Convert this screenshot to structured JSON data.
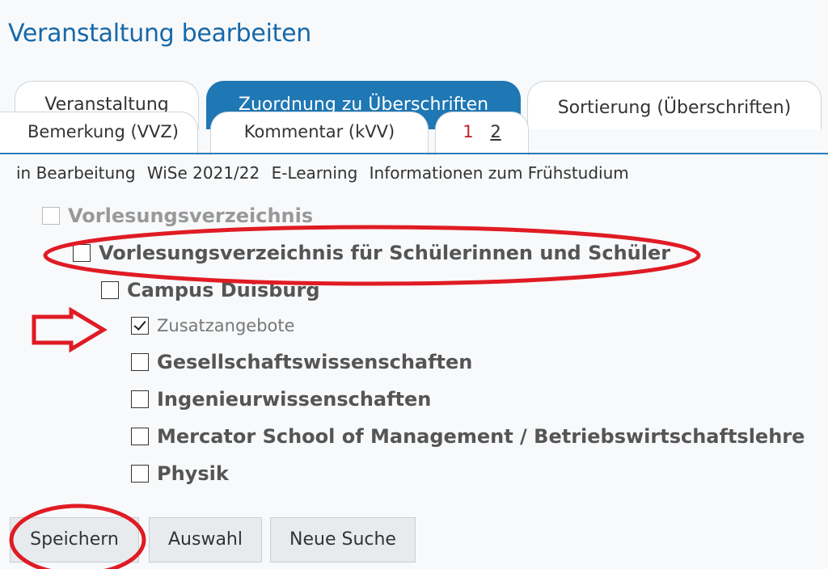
{
  "title": "Veranstaltung bearbeiten",
  "tabs": {
    "veranstaltung": "Veranstaltung",
    "zuordnung": "Zuordnung zu Überschriften",
    "sortierung": "Sortierung (Überschriften)",
    "bemerkung": "Bemerkung (VVZ)",
    "kommentar": "Kommentar (kVV)",
    "page1": "1",
    "page2": "2"
  },
  "status": {
    "state": "in Bearbeitung",
    "semester": "WiSe 2021/22",
    "type": "E-Learning",
    "name": "Informationen zum Frühstudium"
  },
  "tree": {
    "vorlesungsverzeichnis": "Vorlesungsverzeichnis",
    "schueler": "Vorlesungsverzeichnis für Schülerinnen und Schüler",
    "campus": "Campus Duisburg",
    "zusatz": "Zusatzangebote",
    "gesellschaft": "Gesellschaftswissenschaften",
    "ingenieur": "Ingenieurwissenschaften",
    "mercator": "Mercator School of Management / Betriebswirtschaftslehre",
    "physik": "Physik"
  },
  "buttons": {
    "save": "Speichern",
    "select": "Auswahl",
    "new_search": "Neue Suche"
  },
  "colors": {
    "accent": "#1f77b4",
    "title": "#1668a8",
    "annotation": "#e01b24"
  },
  "icons": {
    "arrow": "arrow-right-icon"
  }
}
